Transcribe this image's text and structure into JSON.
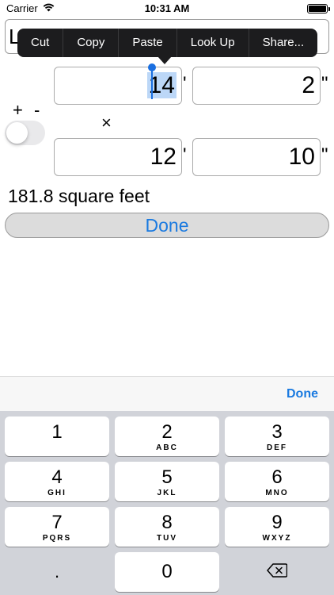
{
  "status": {
    "carrier": "Carrier",
    "time": "10:31 AM"
  },
  "top_field": {
    "visible_text": "L"
  },
  "edit_menu": {
    "items": [
      "Cut",
      "Copy",
      "Paste",
      "Look Up",
      "Share..."
    ]
  },
  "length": {
    "feet": "14",
    "inches": "2",
    "feet_unit": "'",
    "inch_unit": "\""
  },
  "width": {
    "feet": "12",
    "inches": "10",
    "feet_unit": "'",
    "inch_unit": "\""
  },
  "controls": {
    "plus_minus": "+ -",
    "times": "×",
    "toggle_on": false
  },
  "result": "181.8 square feet",
  "done_label": "Done",
  "keyboard": {
    "accessory_done": "Done",
    "keys": [
      {
        "num": "1",
        "letters": ""
      },
      {
        "num": "2",
        "letters": "ABC"
      },
      {
        "num": "3",
        "letters": "DEF"
      },
      {
        "num": "4",
        "letters": "GHI"
      },
      {
        "num": "5",
        "letters": "JKL"
      },
      {
        "num": "6",
        "letters": "MNO"
      },
      {
        "num": "7",
        "letters": "PQRS"
      },
      {
        "num": "8",
        "letters": "TUV"
      },
      {
        "num": "9",
        "letters": "WXYZ"
      },
      {
        "num": "0",
        "letters": ""
      }
    ],
    "decimal": ".",
    "backspace_icon": "backspace-icon"
  }
}
